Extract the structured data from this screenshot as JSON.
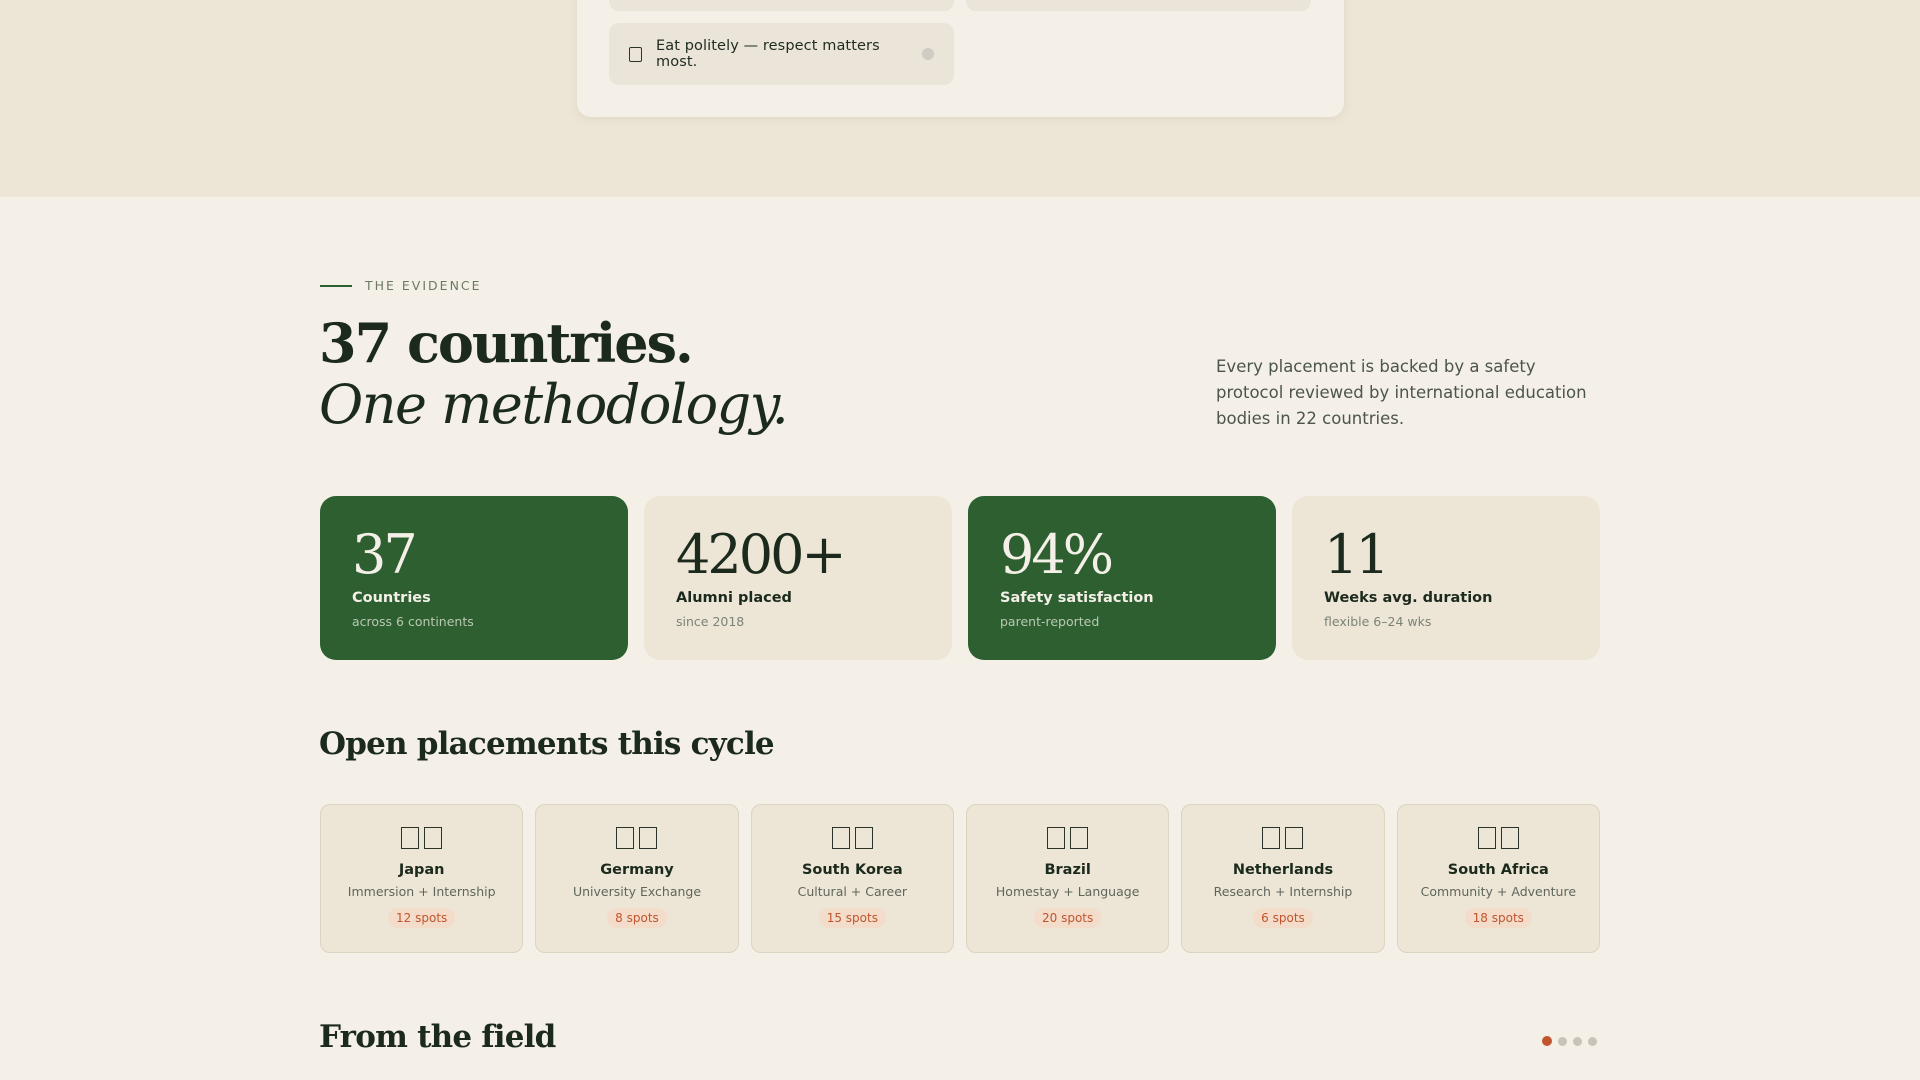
{
  "checklist": {
    "item_label": "Eat politely — respect matters most."
  },
  "evidence": {
    "eyebrow": "THE EVIDENCE",
    "headline_line1": "37 countries.",
    "headline_line2": "One methodology.",
    "intro": "Every placement is backed by a safety protocol reviewed by international education bodies in 22 countries."
  },
  "stats": [
    {
      "value": "37",
      "label": "Countries",
      "sub": "across 6 continents",
      "style": "green"
    },
    {
      "value": "4200+",
      "label": "Alumni placed",
      "sub": "since 2018",
      "style": "cream"
    },
    {
      "value": "94%",
      "label": "Safety satisfaction",
      "sub": "parent-reported",
      "style": "green"
    },
    {
      "value": "11",
      "label": "Weeks avg. duration",
      "sub": "flexible 6–24 wks",
      "style": "cream"
    }
  ],
  "placements": {
    "title": "Open placements this cycle",
    "items": [
      {
        "name": "Japan",
        "type": "Immersion + Internship",
        "spots": "12 spots"
      },
      {
        "name": "Germany",
        "type": "University Exchange",
        "spots": "8 spots"
      },
      {
        "name": "South Korea",
        "type": "Cultural + Career",
        "spots": "15 spots"
      },
      {
        "name": "Brazil",
        "type": "Homestay + Language",
        "spots": "20 spots"
      },
      {
        "name": "Netherlands",
        "type": "Research + Internship",
        "spots": "6 spots"
      },
      {
        "name": "South Africa",
        "type": "Community + Adventure",
        "spots": "18 spots"
      }
    ]
  },
  "field": {
    "title": "From the field",
    "carousel_active_index": 0,
    "carousel_count": 4
  },
  "colors": {
    "accent_green": "#2d5f30",
    "accent_orange": "#c0552e",
    "background": "#f4f0e8",
    "band": "#ede6d6"
  }
}
